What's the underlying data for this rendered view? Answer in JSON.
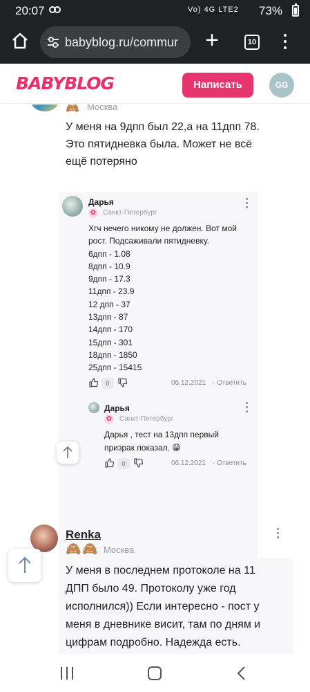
{
  "status_bar": {
    "time": "20:07",
    "sync_icon": "sync-icon",
    "network": "Vo) 4G LTE2",
    "battery_percent": "73%"
  },
  "browser": {
    "url": "babyblog.ru/commur",
    "tab_count": "10"
  },
  "site": {
    "logo": "BABYBLOG",
    "write_button": "Написать",
    "user_initials": "GG",
    "accent_color": "#e7366f"
  },
  "comment_top": {
    "city": "Москва",
    "text": "У меня на 9дпп был 22,а на 11дпп 78. Это пятидневка была. Может не всё ещё потеряно"
  },
  "reply_1": {
    "author": "Дарья",
    "city": "Санкт-Петербург",
    "intro": "Хгч нечего никому не должен. Вот мой рост. Подсаживали пятидневку.",
    "stats": [
      "6дпп - 1.08",
      "8дпп - 10.9",
      "9дпп - 17.3",
      "11дпп - 23.9",
      "12 дпп - 37",
      "13дпп - 87",
      "14дпп - 170",
      "15дпп - 301",
      "18дпп - 1850",
      "25дпп - 15415"
    ],
    "likes": "0",
    "date": "06.12.2021",
    "reply_label": "· Ответить"
  },
  "reply_2": {
    "author": "Дарья",
    "city": "Санкт-Петербург",
    "text": "Дарья , тест на 13дпп первый призрак показал. 😁",
    "likes": "0",
    "date": "06.12.2021",
    "reply_label": "· Ответить"
  },
  "comment_renka": {
    "author": "Renka",
    "city": "Москва",
    "text": "У меня в последнем протоколе на 11 ДПП было 49. Протоколу уже год исполнился)) Если интересно - пост у меня в дневнике висит, там по дням и цифрам подробно. Надежда есть."
  },
  "icons": {
    "badge": "🙈",
    "flower": "✿"
  }
}
